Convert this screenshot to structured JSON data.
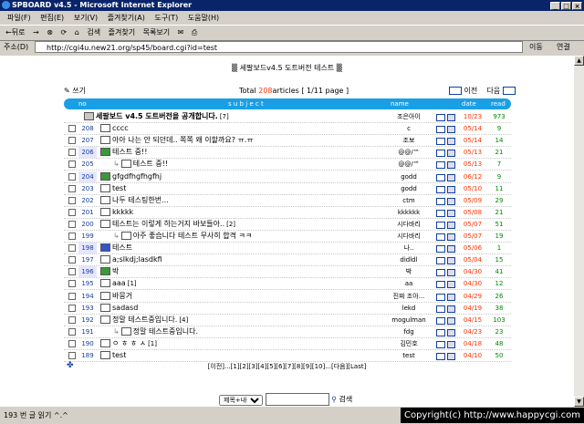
{
  "window": {
    "title": "SPBOARD v4.5 - Microsoft Internet Explorer"
  },
  "menu": [
    "파일(F)",
    "편집(E)",
    "보기(V)",
    "즐겨찾기(A)",
    "도구(T)",
    "도움말(H)"
  ],
  "toolbar": {
    "back": "←뒤로",
    "forward": "→",
    "search": "검색",
    "favorites": "즐겨찾기",
    "history": "목록보기"
  },
  "address": {
    "label": "주소(D)",
    "url": "http://cgi4u.new21.org/sp45/board.cgi?id=test",
    "go": "이동",
    "links": "연결"
  },
  "board": {
    "title": "세팔보드v4.5 도트버전 테스트",
    "write": "쓰기",
    "total_prefix": "Total ",
    "total_count": "208",
    "total_suffix": "articles [ 1/11 page ]",
    "prev": "이전",
    "next": "다음",
    "columns": {
      "no": "no",
      "subject": "s u b j e c t",
      "name": "name",
      "date": "date",
      "read": "read"
    }
  },
  "rows": [
    {
      "no": "",
      "subject": "세팔보드 v4.5 도트버전을 공개합니다.",
      "comments": "[7]",
      "name": "조은아이",
      "date": "10/23",
      "read": "973",
      "icon": "pin",
      "indent": 0,
      "bold": true
    },
    {
      "no": "208",
      "subject": "cccc",
      "comments": "",
      "name": "c",
      "date": "05/14",
      "read": "9",
      "icon": "doc",
      "indent": 0
    },
    {
      "no": "207",
      "subject": "아아 나는 안 되던데.. 쪽쪽 왜 이할까요? ㅠ.ㅠ",
      "comments": "",
      "name": "조보",
      "date": "05/14",
      "read": "14",
      "icon": "doc",
      "indent": 0
    },
    {
      "no": "206",
      "subject": "테스트 중!!",
      "comments": "",
      "name": "@@/™",
      "date": "05/13",
      "read": "21",
      "icon": "grn",
      "indent": 0
    },
    {
      "no": "205",
      "subject": "테스트 중!!",
      "comments": "",
      "name": "@@/™",
      "date": "05/13",
      "read": "7",
      "icon": "doc",
      "indent": 1
    },
    {
      "no": "204",
      "subject": "gfgdfhgfhgfhj",
      "comments": "",
      "name": "godd",
      "date": "06/12",
      "read": "9",
      "icon": "grn",
      "indent": 0
    },
    {
      "no": "203",
      "subject": "test",
      "comments": "",
      "name": "godd",
      "date": "05/10",
      "read": "11",
      "icon": "doc",
      "indent": 0
    },
    {
      "no": "202",
      "subject": "나두 테스팅한번...",
      "comments": "",
      "name": "ctm",
      "date": "05/09",
      "read": "29",
      "icon": "doc",
      "indent": 0
    },
    {
      "no": "201",
      "subject": "kkkkk",
      "comments": "",
      "name": "kkkkkk",
      "date": "05/08",
      "read": "21",
      "icon": "doc",
      "indent": 0
    },
    {
      "no": "200",
      "subject": "테스트는 이렇게 하는거지 바보들아..",
      "comments": "[2]",
      "name": "시다바리",
      "date": "05/07",
      "read": "51",
      "icon": "doc",
      "indent": 0
    },
    {
      "no": "199",
      "subject": "아주 좋습니다 테스트 무사히 합격 ㅋㅋ",
      "comments": "",
      "name": "시다바리",
      "date": "05/07",
      "read": "19",
      "icon": "doc",
      "indent": 1
    },
    {
      "no": "198",
      "subject": "테스트",
      "comments": "",
      "name": "나..",
      "date": "05/06",
      "read": "1",
      "icon": "blu",
      "indent": 0
    },
    {
      "no": "197",
      "subject": "a;slkdj;lasdkfi",
      "comments": "",
      "name": "didldl",
      "date": "05/04",
      "read": "15",
      "icon": "doc",
      "indent": 0
    },
    {
      "no": "196",
      "subject": "박",
      "comments": "",
      "name": "박",
      "date": "04/30",
      "read": "41",
      "icon": "grn",
      "indent": 0
    },
    {
      "no": "195",
      "subject": "aaa",
      "comments": "[1]",
      "name": "aa",
      "date": "04/30",
      "read": "12",
      "icon": "doc",
      "indent": 0
    },
    {
      "no": "194",
      "subject": "바뭉거",
      "comments": "",
      "name": "진짜 조아...",
      "date": "04/29",
      "read": "26",
      "icon": "doc",
      "indent": 0
    },
    {
      "no": "193",
      "subject": "sadasd",
      "comments": "",
      "name": "lekd",
      "date": "04/19",
      "read": "38",
      "icon": "doc",
      "indent": 0
    },
    {
      "no": "192",
      "subject": "정말 테스트중입니다.",
      "comments": "[4]",
      "name": "mogulman",
      "date": "04/15",
      "read": "103",
      "icon": "doc",
      "indent": 0
    },
    {
      "no": "191",
      "subject": "정말 테스트중입니다.",
      "comments": "",
      "name": "fdg",
      "date": "04/23",
      "read": "23",
      "icon": "doc",
      "indent": 1
    },
    {
      "no": "190",
      "subject": "ㅇ ㅎ ㅎ ㅅ",
      "comments": "[1]",
      "name": "김민호",
      "date": "04/18",
      "read": "48",
      "icon": "doc",
      "indent": 0
    },
    {
      "no": "189",
      "subject": "test",
      "comments": "",
      "name": "test",
      "date": "04/10",
      "read": "50",
      "icon": "doc",
      "indent": 0
    }
  ],
  "pagination": "[이전]...[1][2][3][4][5][6][7][8][9][10]...[다음][Last]",
  "search": {
    "select": "제목+내용",
    "button": "검색",
    "input_value": ""
  },
  "status": {
    "text": "193 번 글 읽기 ^.^",
    "copyright": "Copyright(c) http://www.happycgi.com"
  },
  "colors": {
    "header": "#1a9fe6",
    "date": "#ff3300",
    "read": "#008800",
    "number": "#1240a0"
  }
}
